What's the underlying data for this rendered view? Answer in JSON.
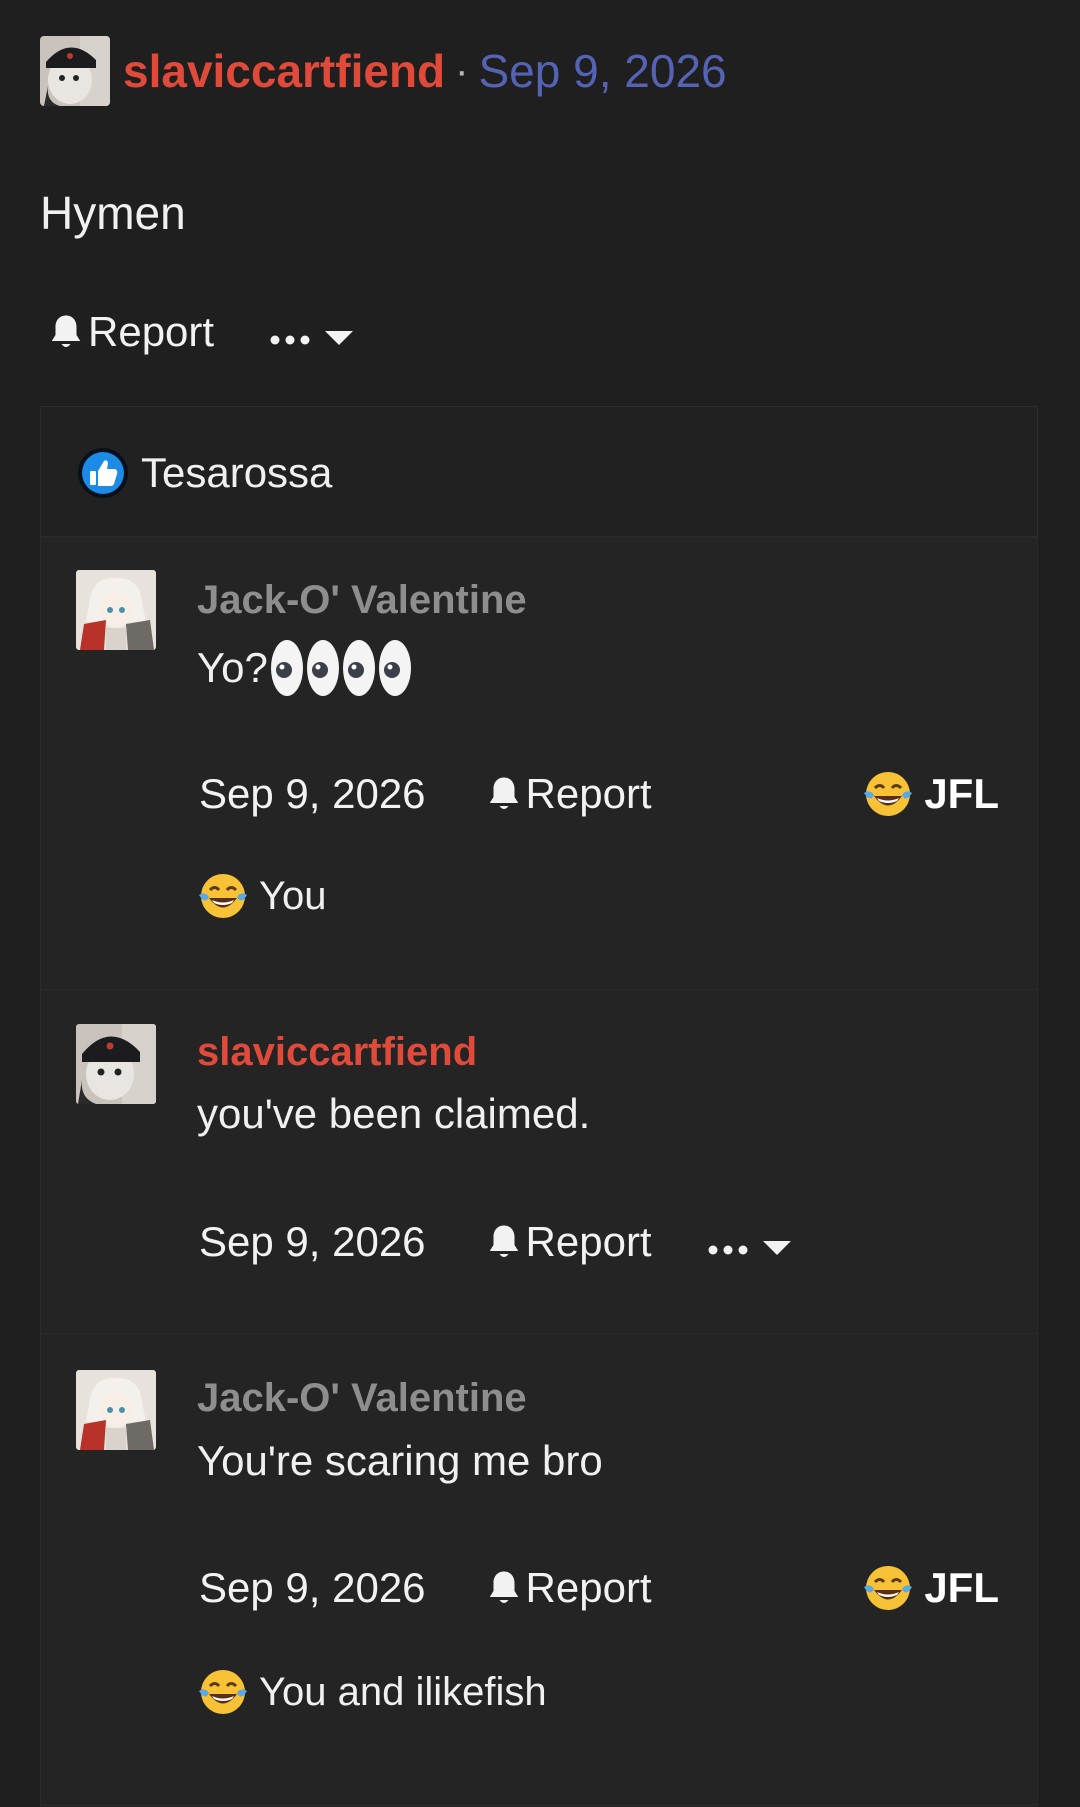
{
  "post": {
    "author": "slaviccartfiend",
    "separator": "·",
    "date": "Sep 9, 2026",
    "body": "Hymen",
    "actions": {
      "report_label": "Report"
    }
  },
  "likes": {
    "icon": "thumbs-up-icon",
    "names": "Tesarossa"
  },
  "comments": [
    {
      "author": "Jack-O' Valentine",
      "text": "Yo?",
      "text_emoji": "eyes x4",
      "date": "Sep 9, 2026",
      "report_label": "Report",
      "reaction_label": "JFL",
      "reaction_icon": "tears-of-joy-icon",
      "reacted_by": "You"
    },
    {
      "author": "slaviccartfiend",
      "text": "you've been claimed.",
      "date": "Sep 9, 2026",
      "report_label": "Report"
    },
    {
      "author": "Jack-O' Valentine",
      "text": "You're scaring me bro",
      "date": "Sep 9, 2026",
      "report_label": "Report",
      "reaction_label": "JFL",
      "reaction_icon": "tears-of-joy-icon",
      "reacted_by": "You and ilikefish"
    }
  ],
  "colors": {
    "background": "#1f1f1f",
    "panel": "#242424",
    "author_red": "#e04a3a",
    "date_blue": "#5563b4",
    "author_gray": "#8e8e8e"
  }
}
